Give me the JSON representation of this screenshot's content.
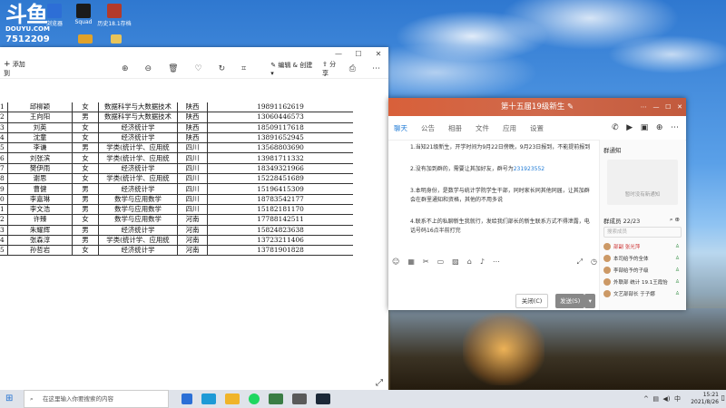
{
  "desktop": {
    "logo": {
      "main": "斗鱼",
      "sub": "DOUYU.COM",
      "room": "7512209"
    },
    "icons": [
      {
        "label": "浏览器",
        "color": "#2d6ed6"
      },
      {
        "label": "Squad",
        "color": "#1b1b1b"
      },
      {
        "label": "历史18.1存档",
        "color": "#b33a2a"
      }
    ]
  },
  "photos": {
    "toolbar": {
      "add_label": "添加到",
      "edit_label": "编辑 & 创建",
      "share_label": "分享"
    },
    "rows": [
      {
        "idx": "1",
        "name": "邱柳颖",
        "gender": "女",
        "major": "数据科学与大数据技术",
        "province": "陕西",
        "phone": "19891162619"
      },
      {
        "idx": "2",
        "name": "王向阳",
        "gender": "男",
        "major": "数据科学与大数据技术",
        "province": "陕西",
        "phone": "13060446573"
      },
      {
        "idx": "3",
        "name": "刘英",
        "gender": "女",
        "major": "经济统计学",
        "province": "陕西",
        "phone": "18509117618"
      },
      {
        "idx": "4",
        "name": "沈童",
        "gender": "女",
        "major": "经济统计学",
        "province": "陕西",
        "phone": "13891652945"
      },
      {
        "idx": "5",
        "name": "李谦",
        "gender": "男",
        "major": "学类(统计学、应用统",
        "province": "四川",
        "phone": "13568803690"
      },
      {
        "idx": "6",
        "name": "刘张滨",
        "gender": "女",
        "major": "学类(统计学、应用统",
        "province": "四川",
        "phone": "13981711332"
      },
      {
        "idx": "7",
        "name": "樊伊雨",
        "gender": "女",
        "major": "经济统计学",
        "province": "四川",
        "phone": "18349321966"
      },
      {
        "idx": "8",
        "name": "谢思",
        "gender": "女",
        "major": "学类(统计学、应用统",
        "province": "四川",
        "phone": "15228451689"
      },
      {
        "idx": "9",
        "name": "曹健",
        "gender": "男",
        "major": "经济统计学",
        "province": "四川",
        "phone": "15196415309"
      },
      {
        "idx": "0",
        "name": "李嘉琳",
        "gender": "男",
        "major": "数学与应用数学",
        "province": "四川",
        "phone": "18783542177"
      },
      {
        "idx": "1",
        "name": "李文浩",
        "gender": "男",
        "major": "数学与应用数学",
        "province": "四川",
        "phone": "15182181170"
      },
      {
        "idx": "2",
        "name": "许臻",
        "gender": "女",
        "major": "数学与应用数学",
        "province": "河南",
        "phone": "17788142511"
      },
      {
        "idx": "3",
        "name": "朱耀辉",
        "gender": "男",
        "major": "经济统计学",
        "province": "河南",
        "phone": "15824823638"
      },
      {
        "idx": "4",
        "name": "张森淳",
        "gender": "男",
        "major": "学类(统计学、应用统",
        "province": "河南",
        "phone": "13723211406"
      },
      {
        "idx": "5",
        "name": "孙哲岩",
        "gender": "女",
        "major": "经济统计学",
        "province": "河南",
        "phone": "13781901828"
      }
    ]
  },
  "chat": {
    "title": "第十五届19级新生",
    "tabs": [
      "聊天",
      "公告",
      "相册",
      "文件",
      "应用",
      "设置"
    ],
    "messages": [
      "1.当知21级新生，开学时间为9月22日傍晚，9月23日报到，不能提前报到",
      "2.没有加到群的，需要让其加好友，群号为",
      "3.本明身份，是数学与统计学院学生干部，同时家长同其他同届，让其加群会在群里通知和资格，其他的不用多说",
      "4.联系不上的私聊新生我就行，发给我们部长的新生联系方式不得泄露，电话号码16点半前打完"
    ],
    "group_number": "231923552",
    "close_label": "关闭(C)",
    "send_label": "发送(S)",
    "side": {
      "notice_title": "群通知",
      "notice_empty": "暂时没有新通知",
      "members_label": "群成员 22/23",
      "search_placeholder": "搜索成员",
      "members": [
        "部副 张光萍",
        "本司给予的全体",
        "李部给予的子级",
        "外联部 统计 19.1王霞怡",
        "文艺部部长 于子娜"
      ]
    }
  },
  "taskbar": {
    "search_placeholder": "在这里输入你要搜索的内容",
    "time": "15:21",
    "date": "2021/8/26"
  }
}
